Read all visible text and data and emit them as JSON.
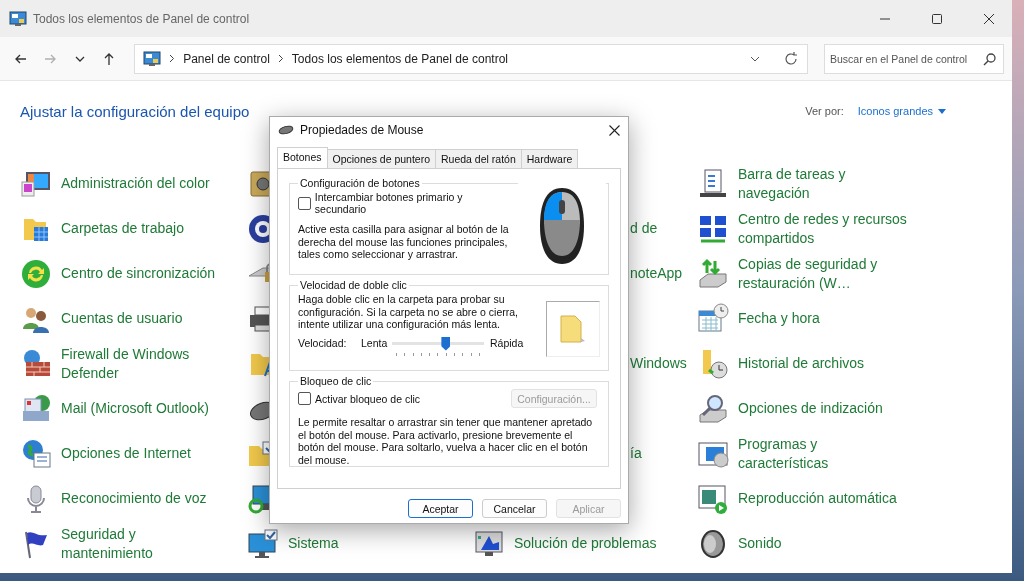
{
  "window": {
    "title": "Todos los elementos de Panel de control"
  },
  "navigation": [
    {
      "kind": "back",
      "disabled": false
    },
    {
      "kind": "forward",
      "disabled": true
    },
    {
      "kind": "recent",
      "disabled": false
    },
    {
      "kind": "up",
      "disabled": false
    }
  ],
  "address_bar": {
    "breadcrumbs": [
      "Panel de control",
      "Todos los elementos de Panel de control"
    ]
  },
  "search": {
    "placeholder": "Buscar en el Panel de control"
  },
  "header": {
    "title": "Ajustar la configuración del equipo",
    "view_by_label": "Ver por:",
    "view_by_value": "Iconos grandes"
  },
  "columns": [
    {
      "items": [
        {
          "kind": "full",
          "label": "Administración del color"
        },
        {
          "kind": "full",
          "label": "Carpetas de trabajo"
        },
        {
          "kind": "full",
          "label": "Centro de sincronización"
        },
        {
          "kind": "full",
          "label": "Cuentas de usuario"
        },
        {
          "kind": "full",
          "label": "Firewall de Windows Defender"
        },
        {
          "kind": "full",
          "label": "Mail (Microsoft Outlook)"
        },
        {
          "kind": "full",
          "label": "Opciones de Internet"
        },
        {
          "kind": "full",
          "label": "Reconocimiento de voz"
        },
        {
          "kind": "full",
          "label": "Seguridad y mantenimiento"
        }
      ]
    },
    {
      "items": [
        {
          "kind": "icon"
        },
        {
          "kind": "icon"
        },
        {
          "kind": "icon"
        },
        {
          "kind": "icon"
        },
        {
          "kind": "icon"
        },
        {
          "kind": "icon"
        },
        {
          "kind": "icon"
        },
        {
          "kind": "icon"
        },
        {
          "kind": "full",
          "label": "Sistema"
        }
      ]
    },
    {
      "items": [
        {
          "kind": "hidden"
        },
        {
          "kind": "tail",
          "label": "d de"
        },
        {
          "kind": "tail",
          "label": "noteApp"
        },
        {
          "kind": "hidden"
        },
        {
          "kind": "tail",
          "label": "Windows"
        },
        {
          "kind": "hidden"
        },
        {
          "kind": "tail",
          "label": "ía"
        },
        {
          "kind": "hidden"
        },
        {
          "kind": "full",
          "label": "Solución de problemas"
        }
      ]
    },
    {
      "items": [
        {
          "kind": "full",
          "label": "Barra de tareas y navegación"
        },
        {
          "kind": "full",
          "label": "Centro de redes y recursos compartidos"
        },
        {
          "kind": "full",
          "label": "Copias de seguridad y restauración (W…"
        },
        {
          "kind": "full",
          "label": "Fecha y hora"
        },
        {
          "kind": "full",
          "label": "Historial de archivos"
        },
        {
          "kind": "full",
          "label": "Opciones de indización"
        },
        {
          "kind": "full",
          "label": "Programas y características"
        },
        {
          "kind": "full",
          "label": "Reproducción automática"
        },
        {
          "kind": "full",
          "label": "Sonido"
        }
      ]
    }
  ],
  "mouse_dialog": {
    "title": "Propiedades de Mouse",
    "tabs": [
      {
        "label": "Botones",
        "selected": true
      },
      {
        "label": "Opciones de puntero",
        "selected": false
      },
      {
        "label": "Rueda del ratón",
        "selected": false
      },
      {
        "label": "Hardware",
        "selected": false
      }
    ],
    "button_config": {
      "title": "Configuración de botones",
      "checkbox": {
        "label": "Intercambiar botones primario y secundario",
        "checked": false
      },
      "description": "Active esta casilla para asignar al botón de la derecha del mouse las funciones principales, tales como seleccionar y arrastrar."
    },
    "double_click": {
      "title": "Velocidad de doble clic",
      "description": "Haga doble clic en la carpeta para probar su configuración. Si la carpeta no se abre o cierra, intente utilizar una configuración más lenta.",
      "speed_label": "Velocidad:",
      "min_label": "Lenta",
      "max_label": "Rápida",
      "level": 0.58
    },
    "click_lock": {
      "title": "Bloqueo de clic",
      "checkbox": {
        "label": "Activar bloqueo de clic",
        "checked": false
      },
      "settings_button": {
        "label": "Configuración...",
        "disabled": true
      },
      "description": "Le permite resaltar o arrastrar sin tener que mantener apretado el botón del mouse. Para activarlo, presione brevemente el botón del mouse. Para soltarlo, vuelva a hacer clic en el botón del mouse."
    },
    "buttons": [
      {
        "label": "Aceptar",
        "kind": "default",
        "disabled": false
      },
      {
        "label": "Cancelar",
        "kind": "normal",
        "disabled": false
      },
      {
        "label": "Aplicar",
        "kind": "normal",
        "disabled": true
      }
    ]
  }
}
